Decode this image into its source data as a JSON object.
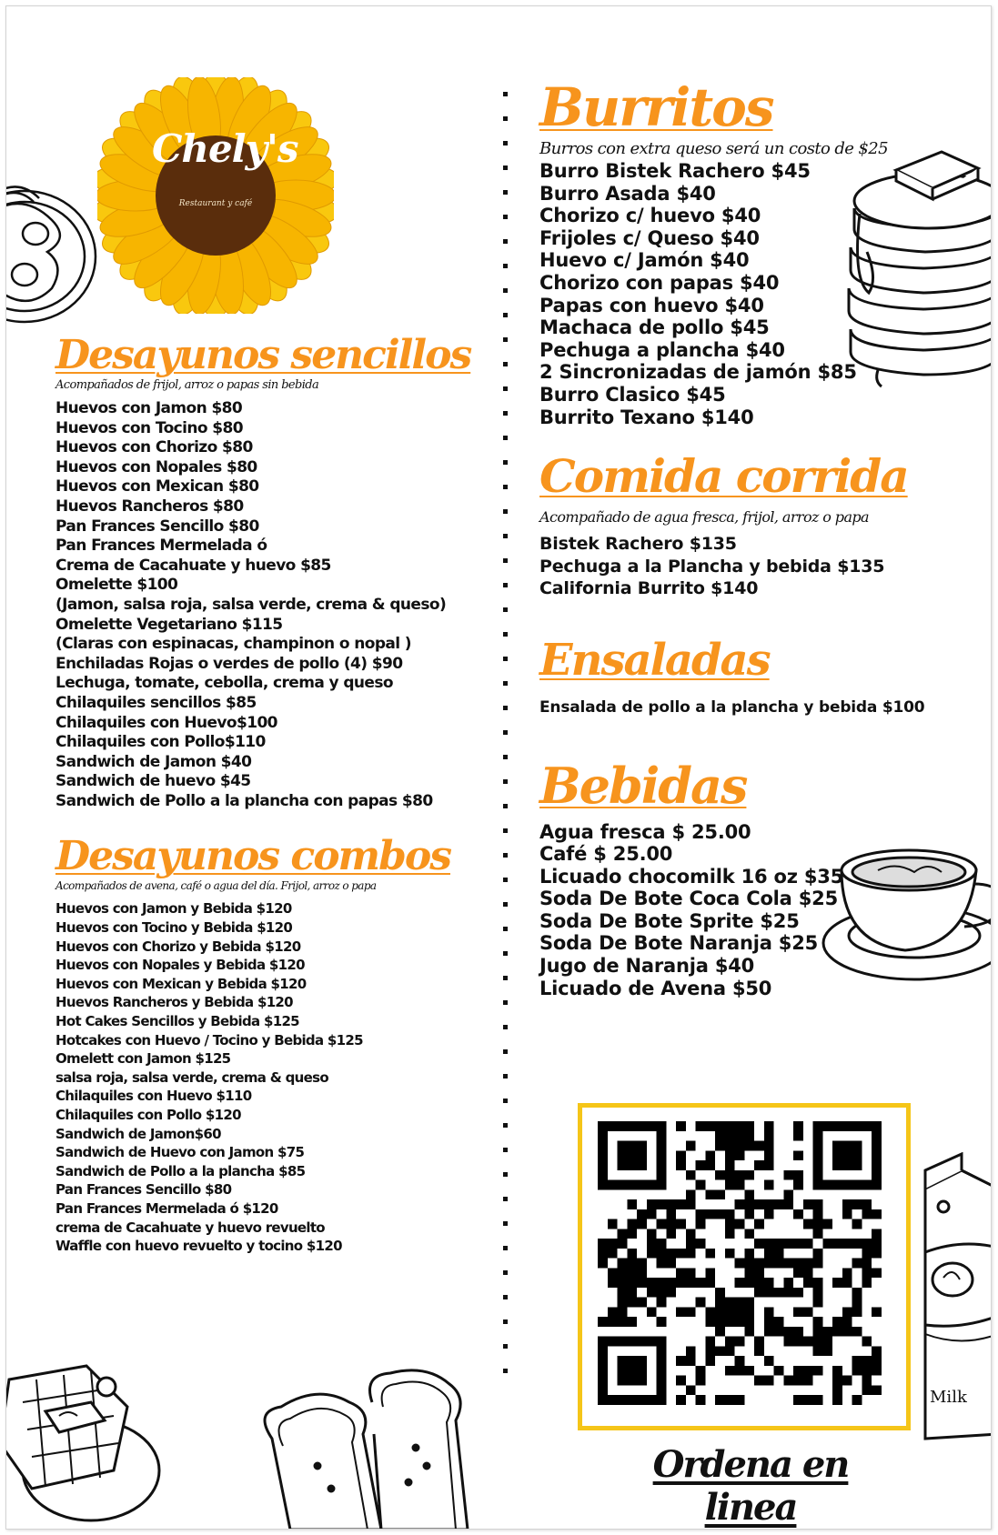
{
  "brand": {
    "name": "Chely's",
    "tagline": "Restaurant y café",
    "colors": {
      "accent": "#f7941d",
      "petal": "#f9c80e",
      "center": "#5a2d0c",
      "qr_frame": "#f5c518"
    }
  },
  "left": {
    "sencillos": {
      "title": "Desayunos sencillos",
      "note": "Acompañados de frijol, arroz o papas sin bebida",
      "items": [
        "Huevos con Jamon $80",
        "Huevos con Tocino $80",
        "Huevos con Chorizo $80",
        "Huevos con Nopales $80",
        "Huevos con Mexican $80",
        "Huevos Rancheros $80",
        "Pan Frances Sencillo $80",
        "Pan Frances Mermelada ó",
        "Crema de Cacahuate y huevo $85",
        "Omelette $100",
        "(Jamon, salsa roja, salsa verde, crema & queso)",
        "Omelette Vegetariano $115",
        "(Claras con espinacas, champinon o nopal )",
        "Enchiladas Rojas o verdes de pollo (4) $90",
        "Lechuga, tomate, cebolla, crema y queso",
        "Chilaquiles sencillos $85",
        "Chilaquiles con Huevo$100",
        "Chilaquiles con Pollo$110",
        "Sandwich de Jamon $40",
        "Sandwich de huevo $45",
        "Sandwich de Pollo a la plancha con papas $80"
      ]
    },
    "combos": {
      "title": "Desayunos combos",
      "note": "Acompañados de avena, café o agua del día. Frijol, arroz o papa",
      "items": [
        "Huevos con Jamon y Bebida $120",
        "Huevos con Tocino y Bebida $120",
        "Huevos con Chorizo y Bebida $120",
        "Huevos con Nopales y Bebida $120",
        "Huevos con Mexican y Bebida $120",
        "Huevos Rancheros y Bebida $120",
        "Hot Cakes Sencillos y Bebida $125",
        "Hotcakes con Huevo / Tocino y Bebida $125",
        "Omelett con Jamon $125",
        "salsa roja, salsa verde, crema & queso",
        "Chilaquiles con Huevo $110",
        "Chilaquiles con Pollo $120",
        "Sandwich de Jamon$60",
        "Sandwich de Huevo con Jamon $75",
        "Sandwich de Pollo a la plancha $85",
        "Pan Frances Sencillo $80",
        "Pan Frances Mermelada ó $120",
        "crema de Cacahuate y huevo revuelto",
        "Waffle con huevo revuelto y tocino $120"
      ]
    }
  },
  "right": {
    "burritos": {
      "title": "Burritos",
      "note": "Burros con extra queso será un costo de $25",
      "items": [
        "Burro Bistek Rachero $45",
        "Burro Asada $40",
        "Chorizo c/ huevo $40",
        "Frijoles c/ Queso $40",
        "Huevo c/ Jamón $40",
        "Chorizo con papas $40",
        "Papas con huevo $40",
        "Machaca de pollo $45",
        "Pechuga a plancha $40",
        "2 Sincronizadas de jamón $85",
        "Burro Clasico $45",
        "Burrito Texano $140"
      ]
    },
    "comida": {
      "title": "Comida corrida",
      "note": "Acompañado de agua fresca, frijol, arroz o papa",
      "items": [
        "Bistek Rachero $135",
        "Pechuga a la Plancha y bebida $135",
        "California Burrito $140"
      ]
    },
    "ensaladas": {
      "title": "Ensaladas",
      "items": [
        "Ensalada de pollo a la plancha y bebida $100"
      ]
    },
    "bebidas": {
      "title": "Bebidas",
      "items": [
        "Agua fresca $ 25.00",
        "Café $ 25.00",
        "Licuado chocomilk 16 oz $35",
        "Soda De Bote Coca Cola $25",
        "Soda De Bote Sprite $25",
        "Soda De Bote Naranja $25",
        "Jugo de Naranja $40",
        "Licuado de Avena $50"
      ]
    }
  },
  "order": {
    "cta": "Ordena en linea"
  },
  "illustrations": {
    "milk_label": "Milk",
    "icons": [
      "fried-eggs-icon",
      "pancake-stack-icon",
      "coffee-cup-icon",
      "milk-carton-icon",
      "waffle-icon",
      "toast-icon",
      "sunflower-icon",
      "qr-code-icon"
    ]
  }
}
